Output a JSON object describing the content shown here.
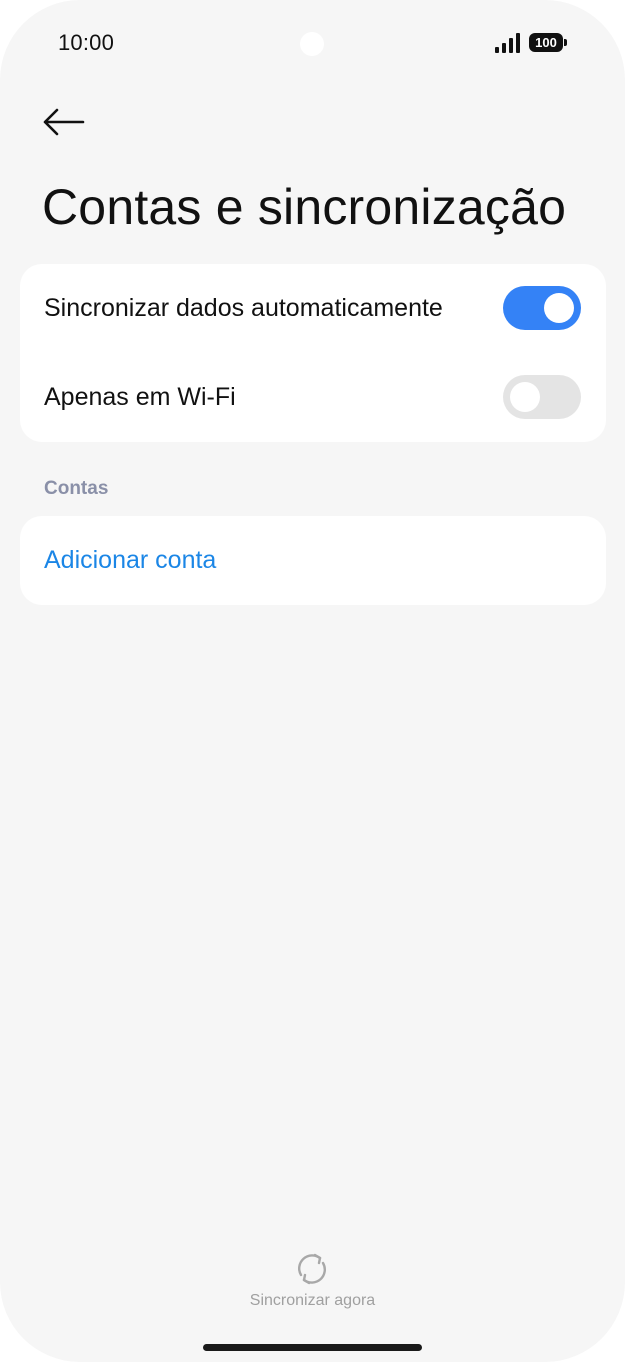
{
  "status_bar": {
    "time": "10:00",
    "battery": "100"
  },
  "header": {
    "back_icon": "arrow-left-icon",
    "title": "Contas e sincronização"
  },
  "sync_settings": {
    "auto_sync": {
      "label": "Sincronizar dados automaticamente",
      "enabled": true
    },
    "wifi_only": {
      "label": "Apenas em Wi-Fi",
      "enabled": false
    }
  },
  "accounts": {
    "section_label": "Contas",
    "add_account_label": "Adicionar conta"
  },
  "footer": {
    "sync_now_icon": "sync-icon",
    "sync_now_label": "Sincronizar agora"
  },
  "colors": {
    "accent": "#3482f6",
    "link": "#1b86e6",
    "background": "#f6f6f6"
  }
}
